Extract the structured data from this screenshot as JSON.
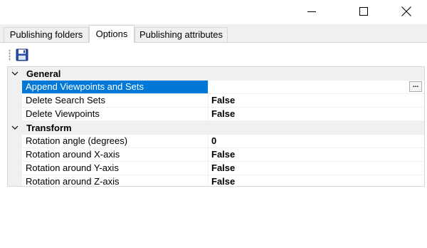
{
  "window": {
    "controls": {
      "minimize_icon": "minimize-icon",
      "maximize_icon": "maximize-icon",
      "close_icon": "close-icon"
    }
  },
  "tabs": [
    {
      "label": "Publishing folders",
      "active": false
    },
    {
      "label": "Options",
      "active": true
    },
    {
      "label": "Publishing attributes",
      "active": false
    }
  ],
  "toolbar": {
    "save_icon": "floppy-disk-save-icon"
  },
  "property_grid": {
    "categories": [
      {
        "label": "General",
        "expanded": true,
        "rows": [
          {
            "name": "Append Viewpoints and Sets",
            "value": "",
            "selected": true,
            "has_ellipsis": true,
            "ellipsis_label": "..."
          },
          {
            "name": "Delete Search Sets",
            "value": "False"
          },
          {
            "name": "Delete Viewpoints",
            "value": "False"
          }
        ]
      },
      {
        "label": "Transform",
        "expanded": true,
        "rows": [
          {
            "name": "Rotation angle (degrees)",
            "value": "0"
          },
          {
            "name": "Rotation around X-axis",
            "value": "False"
          },
          {
            "name": "Rotation around Y-axis",
            "value": "False"
          },
          {
            "name": "Rotation around Z-axis",
            "value": "False"
          }
        ]
      }
    ]
  },
  "colors": {
    "selection": "#0078d7",
    "category_bg": "#f0f0f0",
    "save_icon": "#2b4da8"
  }
}
